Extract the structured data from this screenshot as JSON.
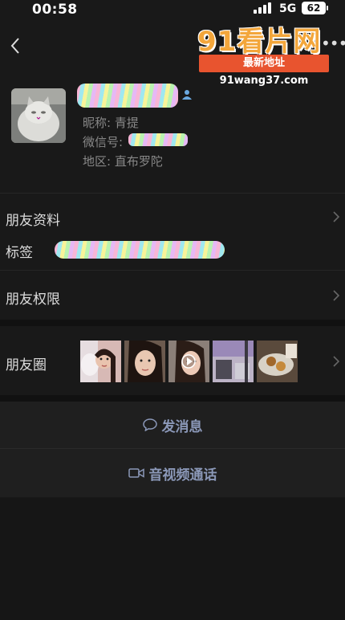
{
  "status_bar": {
    "time": "00:58",
    "network": "5G",
    "battery": "62"
  },
  "watermark": {
    "logo": "91看片网",
    "subtitle": "最新地址91wang37.com"
  },
  "profile": {
    "nickname_label": "昵称: 青提",
    "wechat_id_label": "微信号:",
    "region_label": "地区: 直布罗陀"
  },
  "rows": {
    "friend_profile": "朋友资料",
    "tags": "标签",
    "friend_permissions": "朋友权限",
    "moments": "朋友圈"
  },
  "actions": {
    "send_message": "发消息",
    "voice_video_call": "音视频通话"
  },
  "icons": {
    "back": "chevron-left-icon",
    "more": "more-dots-icon",
    "gender": "person-icon",
    "message": "chat-bubble-icon",
    "video": "video-camera-icon",
    "chevron": "chevron-right-icon"
  },
  "colors": {
    "background": "#191919",
    "action_text": "#8b98b8",
    "watermark_orange": "#f3a63b",
    "watermark_red": "#e8542f"
  }
}
